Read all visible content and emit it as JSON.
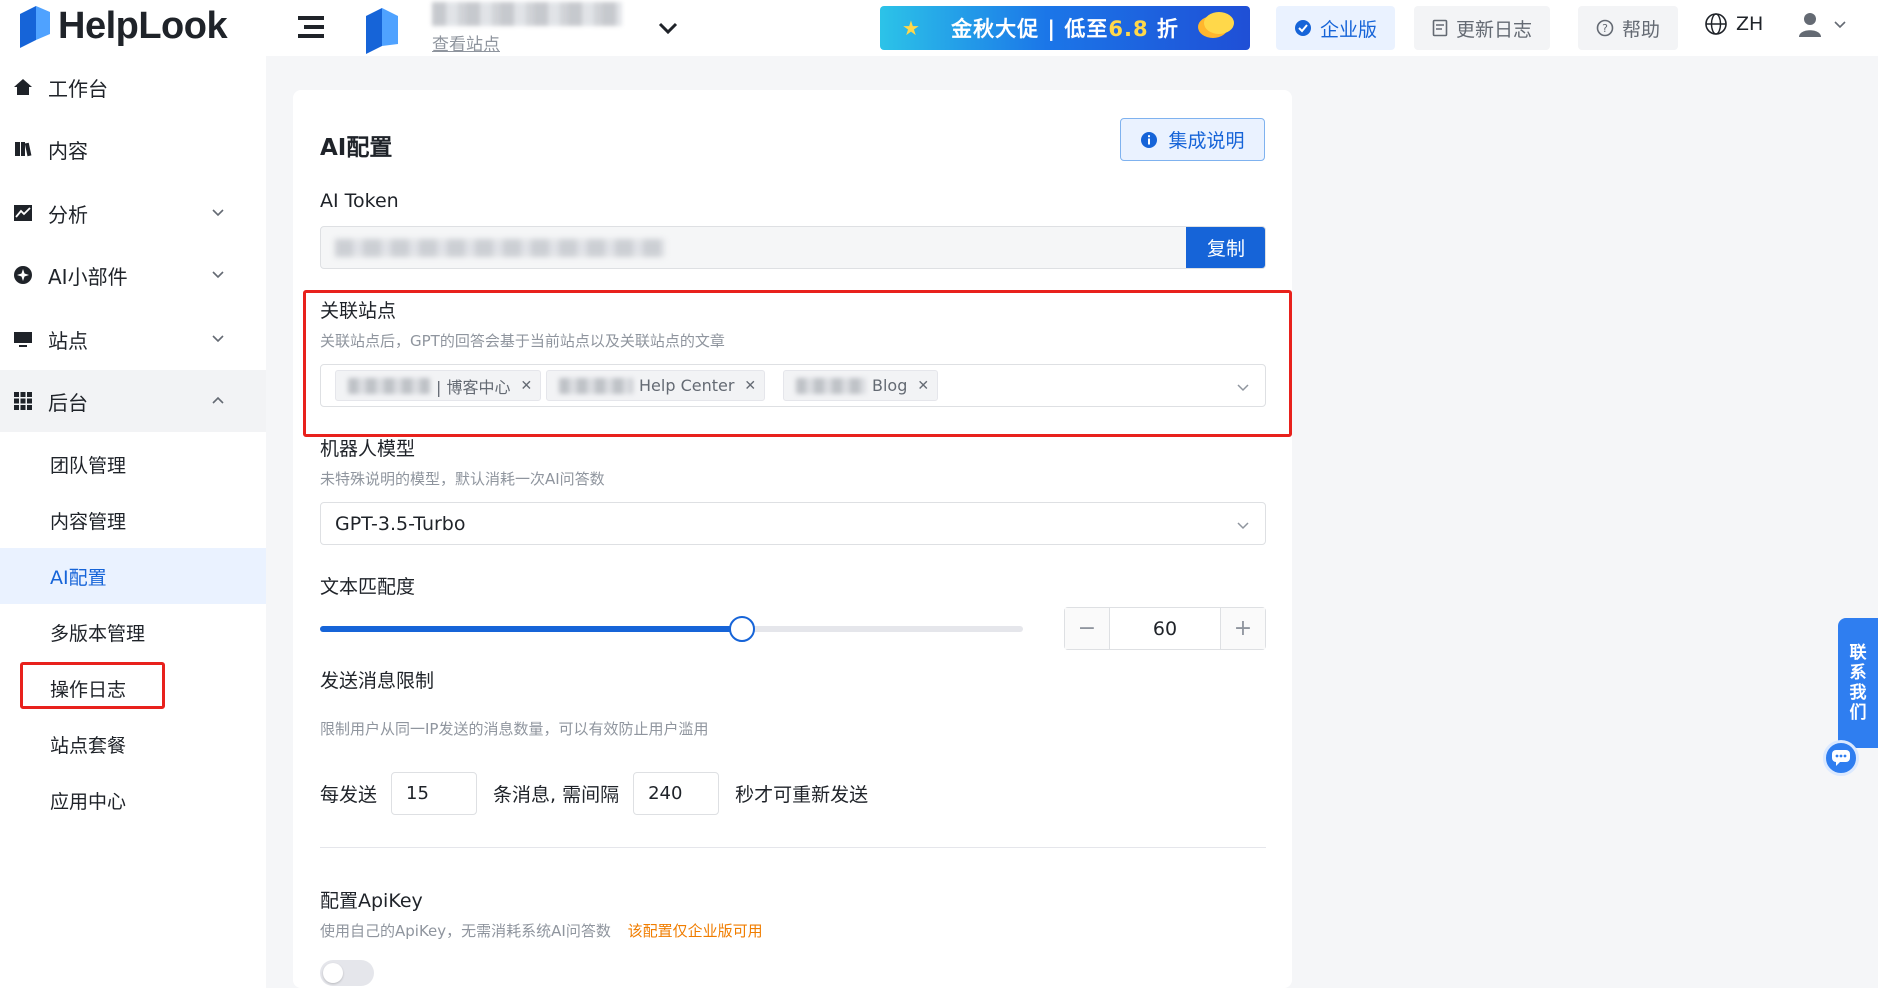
{
  "header": {
    "brand": "HelpLook",
    "view_site": "查看站点",
    "promo_prefix": "金秋大促 | 低至",
    "promo_highlight": "6.8",
    "promo_suffix": "折",
    "enterprise": "企业版",
    "changelog": "更新日志",
    "help": "帮助",
    "language": "ZH"
  },
  "sidebar": {
    "items": [
      {
        "label": "工作台"
      },
      {
        "label": "内容"
      },
      {
        "label": "分析"
      },
      {
        "label": "AI小部件"
      },
      {
        "label": "站点"
      },
      {
        "label": "后台"
      }
    ],
    "sub_items": [
      {
        "label": "团队管理"
      },
      {
        "label": "内容管理"
      },
      {
        "label": "AI配置"
      },
      {
        "label": "多版本管理"
      },
      {
        "label": "操作日志"
      },
      {
        "label": "站点套餐"
      },
      {
        "label": "应用中心"
      }
    ],
    "active_sub": "AI配置"
  },
  "main": {
    "title": "AI配置",
    "guide_button": "集成说明",
    "token": {
      "label": "AI Token",
      "copy": "复制"
    },
    "linked_sites": {
      "label": "关联站点",
      "hint": "关联站点后，GPT的回答会基于当前站点以及关联站点的文章",
      "tags": [
        "| 博客中心",
        "Help Center",
        "Blog"
      ]
    },
    "model": {
      "label": "机器人模型",
      "hint": "未特殊说明的模型，默认消耗一次AI问答数",
      "value": "GPT-3.5-Turbo"
    },
    "match": {
      "label": "文本匹配度",
      "value": "60",
      "min": 0,
      "max": 100,
      "level": 60,
      "minus": "−",
      "plus": "+"
    },
    "rate_limit": {
      "label": "发送消息限制",
      "hint": "限制用户从同一IP发送的消息数量，可以有效防止用户滥用",
      "prefix": "每发送",
      "messages": "15",
      "middle": "条消息, 需间隔",
      "seconds": "240",
      "suffix": "秒才可重新发送"
    },
    "apikey": {
      "label": "配置ApiKey",
      "hint": "使用自己的ApiKey，无需消耗系统AI问答数",
      "warning": "该配置仅企业版可用",
      "enabled": false
    }
  },
  "contact": {
    "chars": [
      "联",
      "系",
      "我",
      "们"
    ]
  },
  "colors": {
    "primary": "#1664d8",
    "highlight": "#e8211c",
    "warning": "#f07d00"
  }
}
